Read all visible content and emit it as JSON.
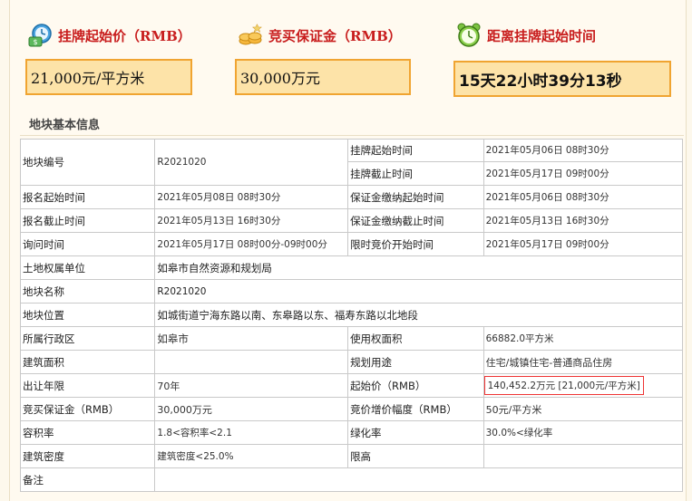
{
  "summary": {
    "start_price": {
      "title": "挂牌起始价（RMB）",
      "value": "21,000元/平方米",
      "icon": "money-clock-icon"
    },
    "deposit": {
      "title": "竞买保证金（RMB）",
      "value": "30,000万元",
      "icon": "coins-icon"
    },
    "countdown": {
      "title": "距离挂牌起始时间",
      "value": "15天22小时39分13秒",
      "icon": "alarm-clock-icon"
    }
  },
  "section": {
    "title": "地块基本信息"
  },
  "rows": {
    "listing_start_label": "挂牌起始时间",
    "listing_start_value": "2021年05月06日 08时30分",
    "parcel_no_label": "地块编号",
    "parcel_no_value": "R2021020",
    "listing_end_label": "挂牌截止时间",
    "listing_end_value": "2021年05月17日 09时00分",
    "reg_start_label": "报名起始时间",
    "reg_start_value": "2021年05月08日 08时30分",
    "dep_start_label": "保证金缴纳起始时间",
    "dep_start_value": "2021年05月06日 08时30分",
    "reg_end_label": "报名截止时间",
    "reg_end_value": "2021年05月13日 16时30分",
    "dep_end_label": "保证金缴纳截止时间",
    "dep_end_value": "2021年05月13日 16时30分",
    "inquiry_label": "询问时间",
    "inquiry_value": "2021年05月17日 08时00分-09时00分",
    "auction_start_label": "限时竞价开始时间",
    "auction_start_value": "2021年05月17日 09时00分",
    "owner_label": "土地权属单位",
    "owner_value": "如皋市自然资源和规划局",
    "name_label": "地块名称",
    "name_value": "R2021020",
    "location_label": "地块位置",
    "location_value": "如城街道宁海东路以南、东皋路以东、福寿东路以北地段",
    "district_label": "所属行政区",
    "district_value": "如皋市",
    "use_area_label": "使用权面积",
    "use_area_value": "66882.0平方米",
    "build_area_label": "建筑面积",
    "build_area_value": "",
    "plan_use_label": "规划用途",
    "plan_use_value": "住宅/城镇住宅-普通商品住房",
    "term_label": "出让年限",
    "term_value": "70年",
    "start_price_label": "起始价（RMB）",
    "start_price_value": "140,452.2万元 [21,000元/平方米]",
    "deposit_label": "竞买保证金（RMB）",
    "deposit_value": "30,000万元",
    "increment_label": "竞价增价幅度（RMB）",
    "increment_value": "50元/平方米",
    "far_label": "容积率",
    "far_value": "1.8<容积率<2.1",
    "green_label": "绿化率",
    "green_value": "30.0%<绿化率",
    "density_label": "建筑密度",
    "density_value": "建筑密度<25.0%",
    "height_label": "限高",
    "height_value": "",
    "remark_label": "备注",
    "remark_value": ""
  }
}
